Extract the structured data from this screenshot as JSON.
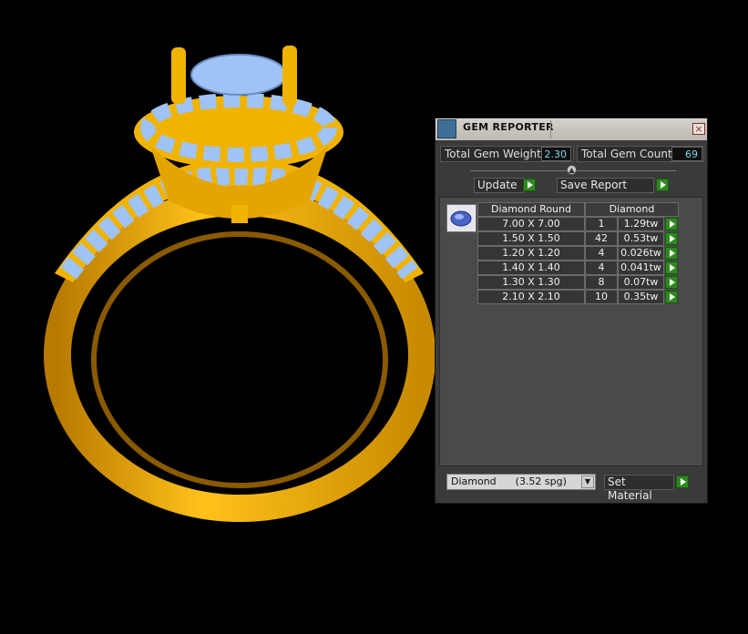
{
  "panel": {
    "title": "GEM REPORTER",
    "close_icon": "close-icon",
    "total_gem_weight_label": "Total Gem Weight",
    "total_gem_weight_value": "2.30",
    "total_gem_count_label": "Total Gem Count",
    "total_gem_count_value": "69",
    "update_label": "Update",
    "save_report_label": "Save Report"
  },
  "report": {
    "gem_icon": "gem-oval-icon",
    "headers": [
      "Diamond Round",
      "Diamond"
    ],
    "rows": [
      {
        "size": "7.00 X 7.00",
        "count": "1",
        "weight": "1.29tw"
      },
      {
        "size": "1.50 X 1.50",
        "count": "42",
        "weight": "0.53tw"
      },
      {
        "size": "1.20 X 1.20",
        "count": "4",
        "weight": "0.026tw"
      },
      {
        "size": "1.40 X 1.40",
        "count": "4",
        "weight": "0.041tw"
      },
      {
        "size": "1.30 X 1.30",
        "count": "8",
        "weight": "0.07tw"
      },
      {
        "size": "2.10 X 2.10",
        "count": "10",
        "weight": "0.35tw"
      }
    ]
  },
  "material": {
    "selected": "Diamond      (3.52 spg)",
    "set_material_label": "Set Material"
  },
  "colors": {
    "gold": "#f0b300",
    "gem": "#9fc3f4",
    "panel_bg": "#3a3a3a",
    "go_green": "#2e8a1f",
    "value_cyan": "#7fd8e8"
  }
}
